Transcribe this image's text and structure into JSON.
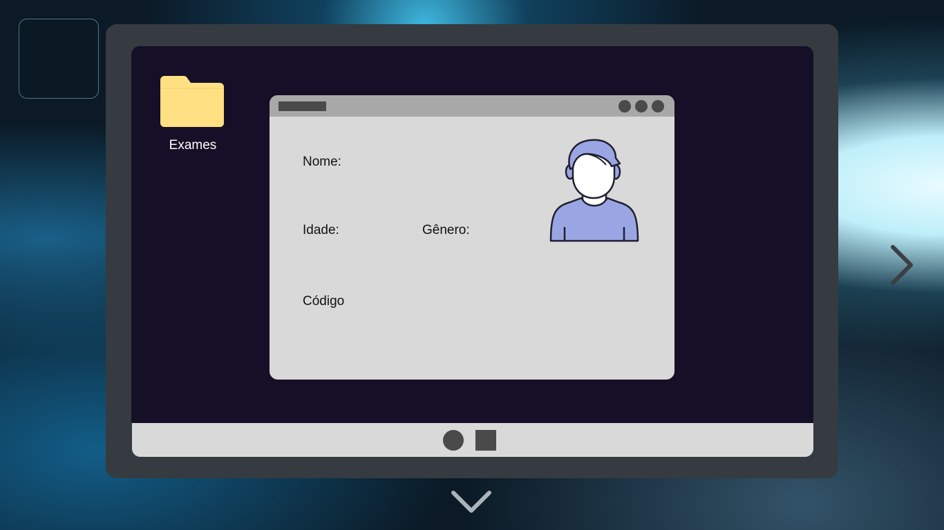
{
  "desktop": {
    "folder": {
      "label": "Exames",
      "icon": "folder-icon",
      "color": "#ffe082"
    }
  },
  "profile_window": {
    "fields": {
      "name_label": "Nome:",
      "age_label": "Idade:",
      "gender_label": "Gênero:",
      "code_label": "Código"
    },
    "avatar_icon": "user-avatar-icon"
  },
  "dock": {
    "items": [
      "circle-button",
      "square-button"
    ]
  },
  "navigation": {
    "next_icon": "chevron-right-icon",
    "down_icon": "chevron-down-icon"
  },
  "colors": {
    "frame": "#353b40",
    "screen": "#150f27",
    "window": "#d9d9d9",
    "titlebar": "#a8a8a8",
    "avatar_shirt": "#9aa6e4",
    "folder": "#ffe082"
  }
}
